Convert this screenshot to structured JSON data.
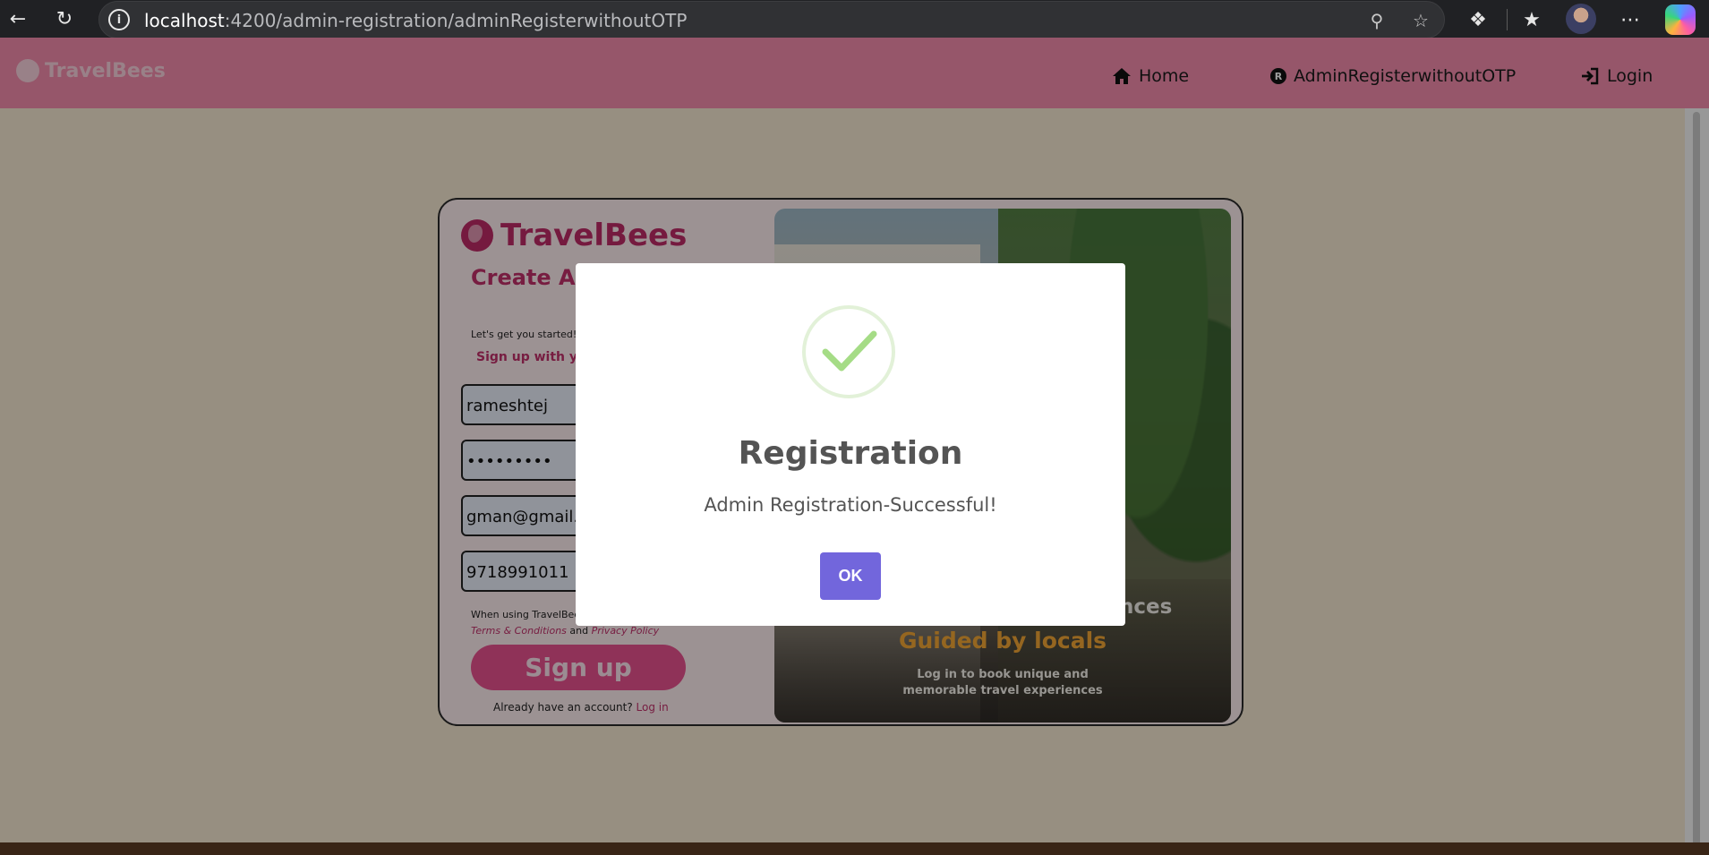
{
  "browser": {
    "url_host": "localhost",
    "url_path": ":4200/admin-registration/adminRegisterwithoutOTP"
  },
  "navbar": {
    "brand": "TravelBees",
    "links": [
      {
        "label": "Home",
        "icon": "home-icon"
      },
      {
        "label": "AdminRegisterwithoutOTP",
        "icon": "r-badge-icon"
      },
      {
        "label": "Login",
        "icon": "login-icon"
      }
    ],
    "bg_color": "#f28cab"
  },
  "form": {
    "logo": "TravelBees",
    "heading": "Create ADMIN account",
    "subtitle": "Let's get you started! F",
    "signup_with": "Sign up with you",
    "fields": [
      "rameshtej",
      "•••••••••",
      "gman@gmail.c",
      "9718991011"
    ],
    "terms_prefix": "When using TravelBee",
    "terms_link": "Terms & Conditions",
    "terms_and": "and",
    "privacy_link": "Privacy Policy",
    "signup_button": "Sign up",
    "already_text": "Already have an account?",
    "login_link": "Log in"
  },
  "photo": {
    "tagline_1": "nces",
    "tagline_2": "Guided by locals",
    "tagline_3": "Log in to book unique and memorable travel experiences"
  },
  "modal": {
    "title": "Registration",
    "message": "Admin Registration-Successful!",
    "ok_button": "OK",
    "accent_color": "#7266dc",
    "success_color": "#a5dc86"
  }
}
